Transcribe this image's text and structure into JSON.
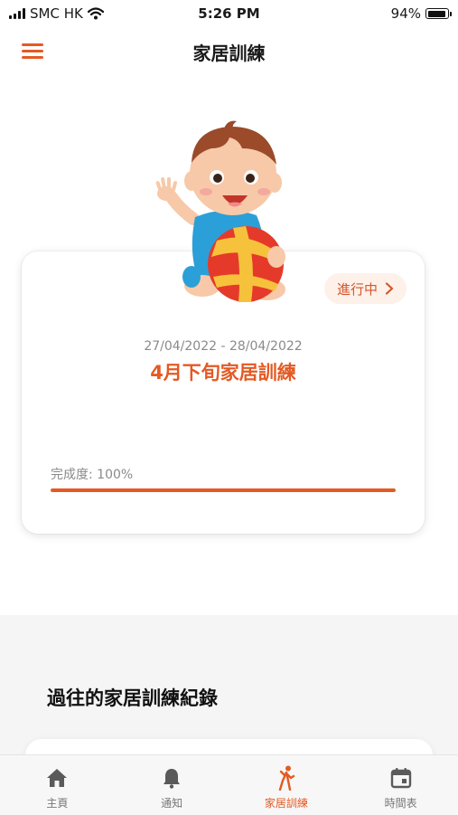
{
  "status_bar": {
    "carrier": "SMC HK",
    "time": "5:26 PM",
    "battery_percent": "94%",
    "battery_level": 0.94
  },
  "header": {
    "title": "家居訓練",
    "menu_icon": "hamburger-menu-icon"
  },
  "current_training": {
    "status_label": "進行中",
    "date_range": "27/04/2022 - 28/04/2022",
    "name": "4月下旬家居訓練",
    "progress_label": "完成度: 100%",
    "progress_value": 1.0,
    "illustration": "baby-with-ball"
  },
  "history": {
    "title": "過往的家居訓練紀錄"
  },
  "tabs": [
    {
      "label": "主頁",
      "icon": "home-icon",
      "active": false
    },
    {
      "label": "通知",
      "icon": "bell-icon",
      "active": false
    },
    {
      "label": "家居訓練",
      "icon": "exercise-icon",
      "active": true
    },
    {
      "label": "時間表",
      "icon": "calendar-icon",
      "active": false
    }
  ],
  "colors": {
    "accent": "#e35a24",
    "accent_light": "#fdf1ea",
    "muted_text": "#8a8a8a",
    "section_bg": "#f5f5f5"
  }
}
